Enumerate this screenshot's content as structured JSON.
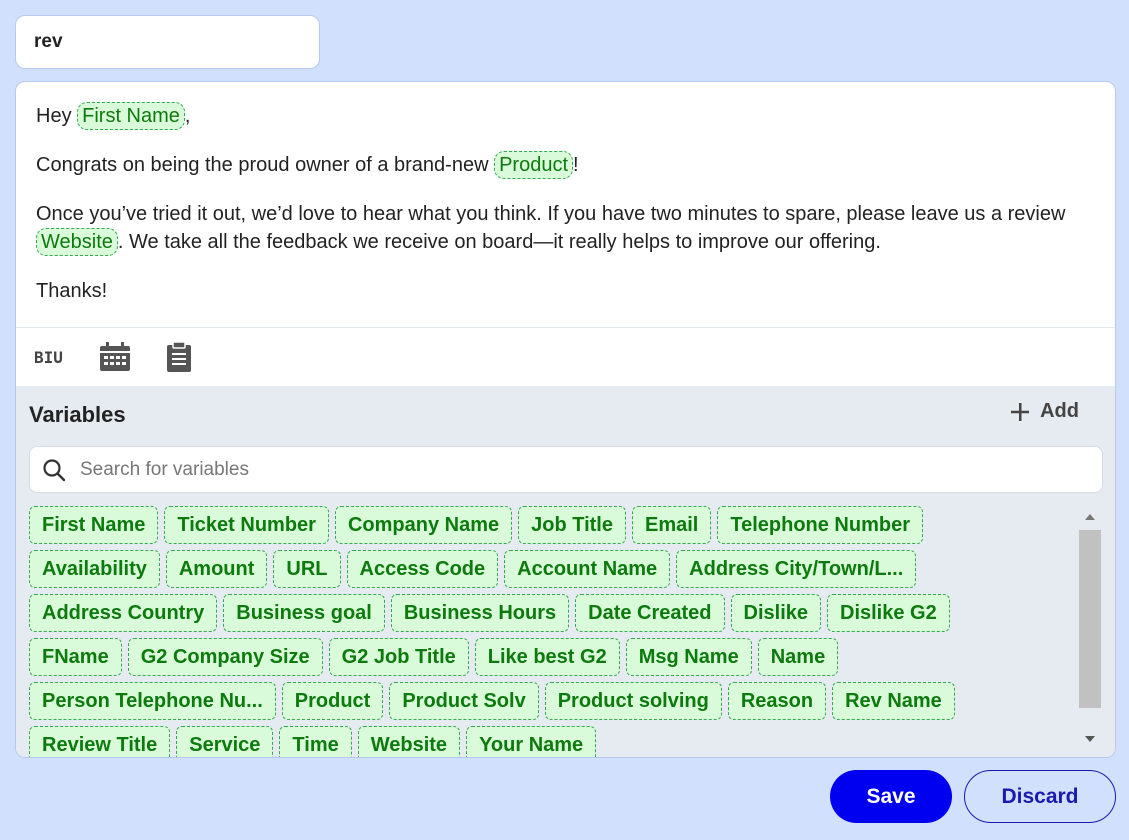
{
  "template_name": "rev",
  "message": {
    "greeting_prefix": "Hey ",
    "greeting_var": "First Name",
    "greeting_suffix": ",",
    "line2_prefix": "Congrats on being the proud owner of a brand-new ",
    "line2_var": "Product",
    "line2_suffix": "!",
    "line3_prefix": "Once you’ve tried it out, we’d love to hear what you think. If you have two minutes to spare, please leave us a review ",
    "line3_var": "Website",
    "line3_suffix": ". We take all the feedback we receive on board—it really helps to improve our offering.",
    "sign_off": "Thanks!"
  },
  "toolbar": {
    "format_icon": "text-format-icon",
    "calendar_icon": "calendar-icon",
    "clipboard_icon": "clipboard-icon",
    "format_label": "BIU"
  },
  "variables": {
    "title": "Variables",
    "add_label": "Add",
    "search_placeholder": "Search for variables",
    "rows": [
      [
        "First Name",
        "Ticket Number",
        "Company Name",
        "Job Title",
        "Email",
        "Telephone Number"
      ],
      [
        "Availability",
        "Amount",
        "URL",
        "Access Code",
        "Account Name",
        "Address City/Town/L..."
      ],
      [
        "Address Country",
        "Business goal",
        "Business Hours",
        "Date Created",
        "Dislike",
        "Dislike G2"
      ],
      [
        "FName",
        "G2 Company Size",
        "G2 Job Title",
        "Like best G2",
        "Msg Name",
        "Name"
      ],
      [
        "Person Telephone Nu...",
        "Product",
        "Product Solv",
        "Product solving",
        "Reason",
        "Rev Name"
      ],
      [
        "Review Title",
        "Service",
        "Time",
        "Website",
        "Your Name"
      ]
    ]
  },
  "actions": {
    "save_label": "Save",
    "discard_label": "Discard"
  },
  "colors": {
    "page_bg": "#d1e0fc",
    "primary": "#0000f0",
    "chip_bg": "#d9fbd9",
    "chip_text": "#0d7a0d"
  }
}
